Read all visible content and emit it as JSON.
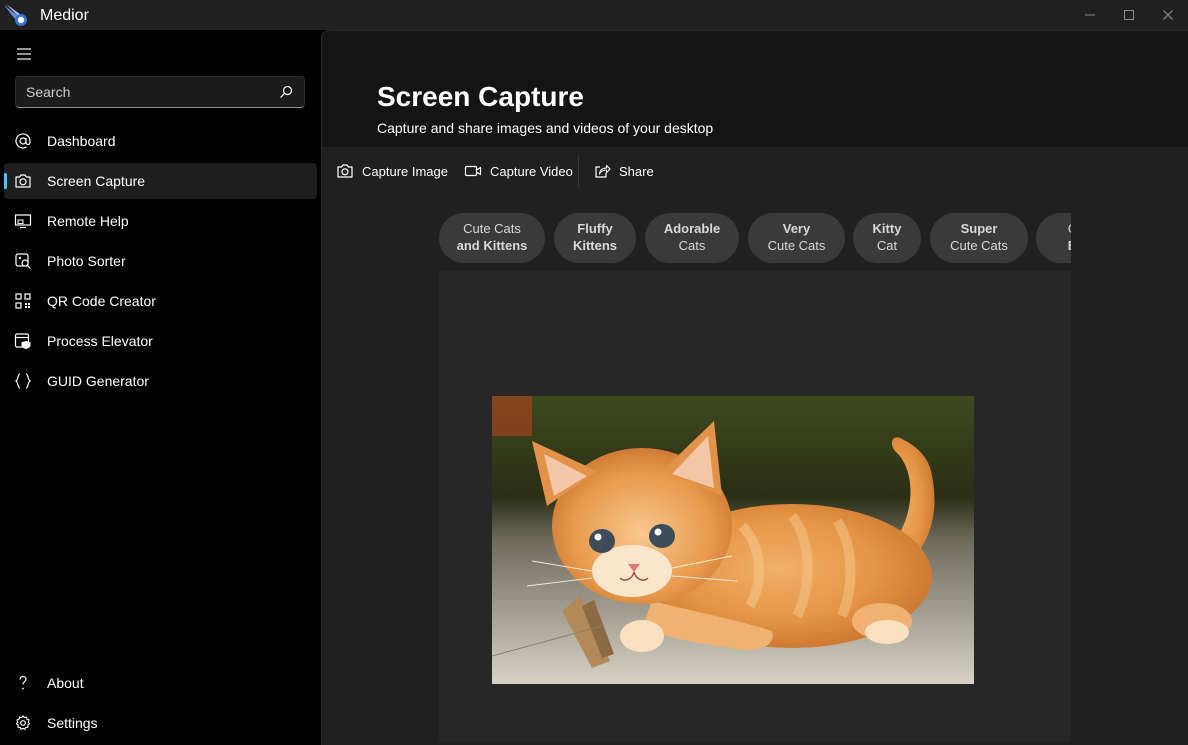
{
  "app": {
    "title": "Medior"
  },
  "window_controls": {
    "minimize": "—",
    "maximize": "☐",
    "close": "✕"
  },
  "sidebar": {
    "search_placeholder": "Search",
    "items": [
      {
        "label": "Dashboard",
        "icon": "at-icon",
        "selected": false
      },
      {
        "label": "Screen Capture",
        "icon": "camera-icon",
        "selected": true
      },
      {
        "label": "Remote Help",
        "icon": "remote-screen-icon",
        "selected": false
      },
      {
        "label": "Photo Sorter",
        "icon": "photo-search-icon",
        "selected": false
      },
      {
        "label": "QR Code Creator",
        "icon": "qr-code-icon",
        "selected": false
      },
      {
        "label": "Process Elevator",
        "icon": "shield-app-icon",
        "selected": false
      },
      {
        "label": "GUID Generator",
        "icon": "braces-icon",
        "selected": false
      }
    ],
    "footer_items": [
      {
        "label": "About",
        "icon": "question-icon"
      },
      {
        "label": "Settings",
        "icon": "gear-icon"
      }
    ]
  },
  "page": {
    "title": "Screen Capture",
    "subtitle": "Capture and share images and videos of your desktop"
  },
  "toolbar": {
    "capture_image": "Capture Image",
    "capture_video": "Capture Video",
    "share": "Share"
  },
  "preview": {
    "chips": [
      {
        "bold": "Cute Cats",
        "rest": "and Kittens",
        "rest_bold": true
      },
      {
        "bold": "Fluffy",
        "rest": "Kittens",
        "rest_bold": true
      },
      {
        "bold": "Adorable",
        "rest": "Cats",
        "rest_bold": false
      },
      {
        "bold": "Very",
        "rest": "Cute Cats",
        "rest_bold": false
      },
      {
        "bold": "Kitty",
        "rest": "Cat",
        "rest_bold": false
      },
      {
        "bold": "Super",
        "rest": "Cute Cats",
        "rest_bold": false
      },
      {
        "bold": "Cu",
        "rest": "Ba",
        "rest_bold": true
      }
    ]
  },
  "colors": {
    "accent": "#4cc2ff",
    "sidebar_bg": "#000000",
    "content_bg": "#202020",
    "header_bg": "#141414"
  }
}
